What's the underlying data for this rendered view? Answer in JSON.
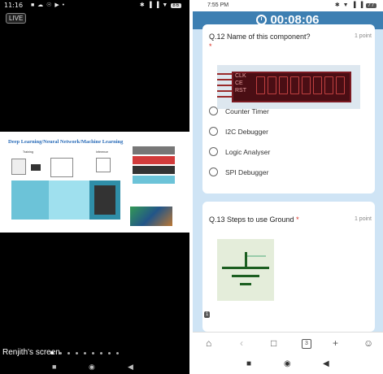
{
  "left_phone": {
    "status_time": "11:16",
    "status_icons": "■ ☁ ☉ ▶ •",
    "status_right": "✱ ▐ ▐ ▼",
    "battery": "86",
    "live_label": "LIVE",
    "slide": {
      "title": "Deep Learning/Neural Network/Machine Learning",
      "label_training": "Training",
      "label_inference": "Inference",
      "label_unlabeled": "Unlabeled"
    },
    "screen_owner": "Renjith's screen",
    "page_dots": 9,
    "active_dot": 0,
    "nav": {
      "back": "◀",
      "home": "◉",
      "recents": "■"
    }
  },
  "right_phone": {
    "status_time": "7:55 PM",
    "status_right": "✱ ▼ ▐ ▐",
    "battery": "77",
    "timer": "00:08:06",
    "questions": [
      {
        "title": "Q.12 Name of this component?",
        "required": "*",
        "points": "1 point",
        "component_pins": [
          "CLK",
          "CE",
          "RST"
        ],
        "options": [
          "Counter Timer",
          "I2C Debugger",
          "Logic Analyser",
          "SPI Debugger"
        ]
      },
      {
        "title": "Q.13 Steps to use Ground",
        "required": "*",
        "points": "1 point"
      }
    ],
    "page_badge": "1",
    "toolbar": {
      "home": "⌂",
      "back": "‹",
      "reader": "□",
      "tabs_count": "3",
      "add": "+",
      "profile": "☺"
    },
    "nav": {
      "recents": "■",
      "home": "◉",
      "back": "◀"
    }
  }
}
